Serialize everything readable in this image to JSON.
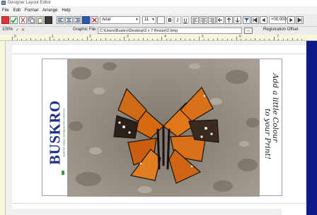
{
  "window": {
    "title": "Designer Layout Editor"
  },
  "menu": [
    "File",
    "Edit",
    "Format",
    "Arrange",
    "Help"
  ],
  "toolbar": {
    "font": "Arial",
    "size": "11",
    "bold": "B",
    "italic": "I",
    "underline": "U",
    "offset_value": "+00.000"
  },
  "row2": {
    "zoom": "100%",
    "graphic_file_label": "Graphic File:",
    "graphic_file_path": "C:\\Users\\Buskro\\Desktop\\3 x 7 Resize\\2.bmp",
    "browse": "...",
    "registration_label": "Registration Offset"
  },
  "ruler": {
    "numbers": [
      "0",
      "1",
      "2",
      "3",
      "4",
      "5",
      "6",
      "7"
    ]
  },
  "logo": {
    "brand": "BUSKRO",
    "tagline": "Built for today | Designed for tomorrow"
  },
  "slogan": {
    "line1": "Add a little Colour",
    "line2": "to your Print!"
  },
  "colors": {
    "navy": "#0c1a8c",
    "brand_blue": "#1d2f8a",
    "brand_green": "#2fa23a"
  }
}
